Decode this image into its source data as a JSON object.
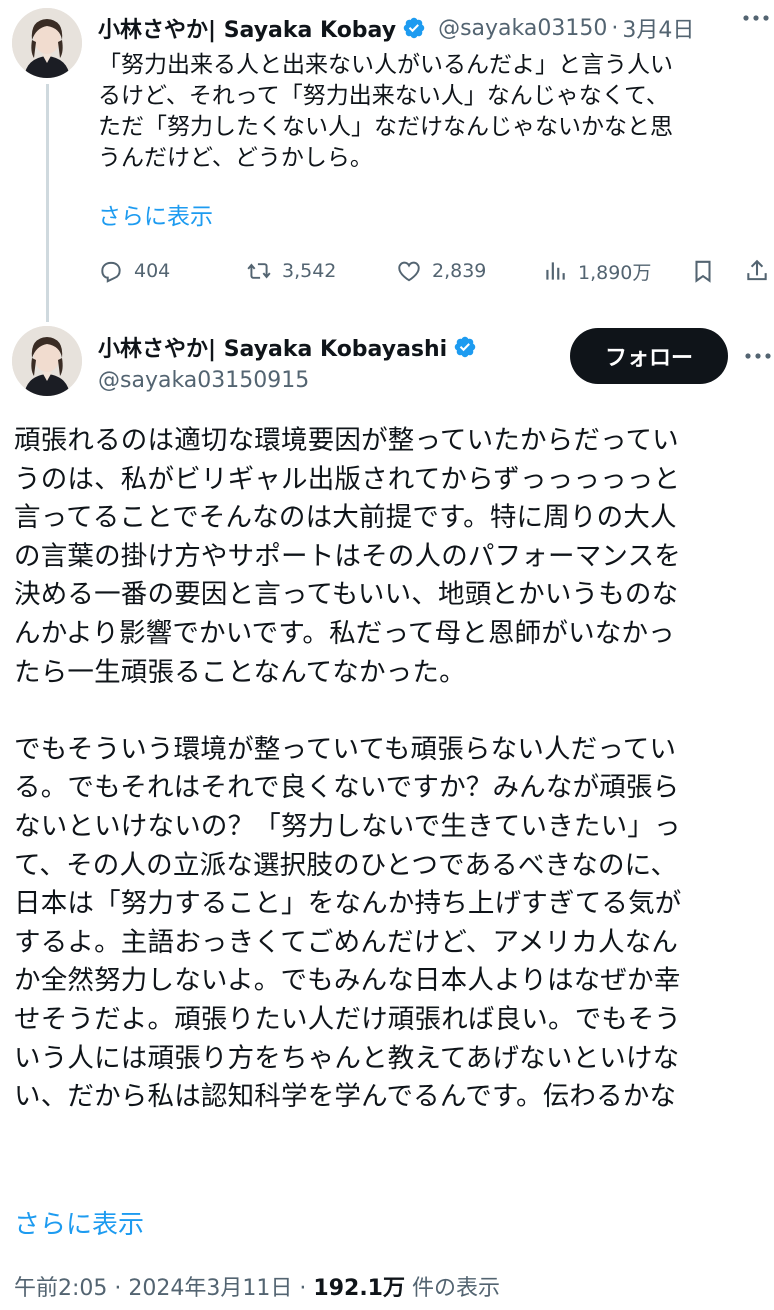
{
  "colors": {
    "accent": "#1d9bf0",
    "text": "#0f1419",
    "secondary": "#536471",
    "follow_bg": "#0f1419"
  },
  "tweet1": {
    "display_name": "小林さやか| Sayaka Kobay",
    "handle": "@sayaka03150",
    "separator": "·",
    "date": "3月4日",
    "lines": [
      "「努力出来る人と出来ない人がいるんだよ」と言う人い",
      "るけど、それって「努力出来ない人」なんじゃなくて、",
      "ただ「努力したくない人」なだけなんじゃないかなと思",
      "うんだけど、どうかしら。"
    ],
    "show_more": "さらに表示",
    "actions": {
      "replies": "404",
      "retweets": "3,542",
      "likes": "2,839",
      "views": "1,890万"
    },
    "icons": [
      "reply-icon",
      "retweet-icon",
      "like-icon",
      "views-icon",
      "bookmark-icon",
      "share-icon"
    ]
  },
  "tweet2": {
    "display_name": "小林さやか| Sayaka Kobayashi",
    "handle": "@sayaka03150915",
    "follow_label": "フォロー",
    "paragraph1": [
      "頑張れるのは適切な環境要因が整っていたからだってい",
      "うのは、私がビリギャル出版されてからずっっっっっと",
      "言ってることでそんなのは大前提です。特に周りの大人",
      "の言葉の掛け方やサポートはその人のパフォーマンスを",
      "決める一番の要因と言ってもいい、地頭とかいうものな",
      "んかより影響でかいです。私だって母と恩師がいなかっ",
      "たら一生頑張ることなんてなかった。"
    ],
    "paragraph2": [
      "でもそういう環境が整っていても頑張らない人だってい",
      "る。でもそれはそれで良くないですか？みんなが頑張ら",
      "ないといけないの？「努力しないで生きていきたい」っ",
      "て、その人の立派な選択肢のひとつであるべきなのに、",
      "日本は「努力すること」をなんか持ち上げすぎてる気が",
      "するよ。主語おっきくてごめんだけど、アメリカ人なん",
      "か全然努力しないよ。でもみんな日本人よりはなぜか幸",
      "せそうだよ。頑張りたい人だけ頑張れば良い。でもそう",
      "いう人には頑張り方をちゃんと教えてあげないといけな",
      "い、だから私は認知科学を学んでるんです。伝わるかな"
    ],
    "show_more": "さらに表示",
    "meta": {
      "time": "午前2:05",
      "separator": "·",
      "date": "2024年3月11日",
      "views_count": "192.1万",
      "views_label": "件の表示"
    }
  }
}
